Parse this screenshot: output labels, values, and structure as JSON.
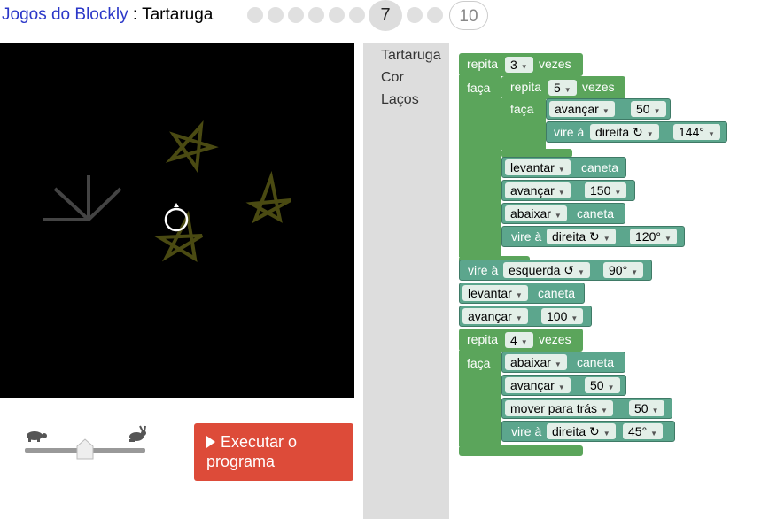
{
  "header": {
    "app_title": "Jogos do Blockly",
    "separator": " : ",
    "game_title": "Tartaruga",
    "current_level": "7",
    "final_level": "10"
  },
  "controls": {
    "run_label": "Executar o programa",
    "speed_level": 0.5
  },
  "toolbox": {
    "categories": [
      "Tartaruga",
      "Cor",
      "Laços"
    ]
  },
  "blocks": {
    "repita": "repita",
    "vezes": "vezes",
    "faca": "faça",
    "avancar": "avançar",
    "vire_a": "vire à",
    "direita": "direita ↻",
    "esquerda": "esquerda ↺",
    "levantar": "levantar",
    "abaixar": "abaixar",
    "caneta": "caneta",
    "mover_para_tras": "mover para trás",
    "loop1_count": "3",
    "loop2_count": "5",
    "loop3_count": "4",
    "v_50": "50",
    "v_144": "144°",
    "v_150": "150",
    "v_120": "120°",
    "v_90": "90°",
    "v_100": "100",
    "v_45": "45°"
  },
  "colors": {
    "stage_bg": "#000000",
    "star_stroke": "#4a4a12",
    "loop_block": "#5ba55b",
    "turtle_block": "#5ca68d",
    "run_button": "#dd4b39",
    "title_link": "#2b37c8"
  }
}
